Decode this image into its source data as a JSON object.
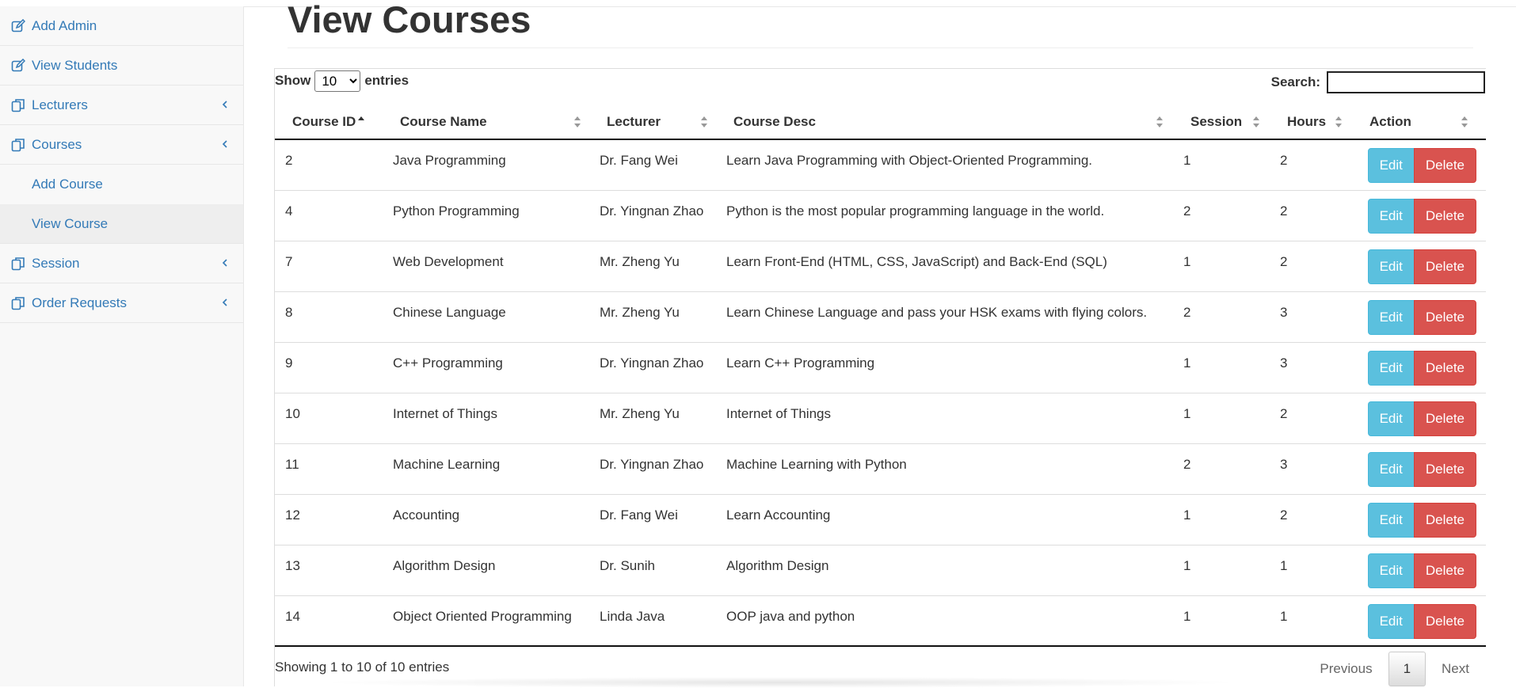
{
  "sidebar": {
    "items": [
      {
        "label": "Add Admin",
        "icon": "edit-icon"
      },
      {
        "label": "View Students",
        "icon": "edit-icon"
      },
      {
        "label": "Lecturers",
        "icon": "copy-icon"
      },
      {
        "label": "Courses",
        "icon": "copy-icon"
      },
      {
        "label": "Session",
        "icon": "copy-icon"
      },
      {
        "label": "Order Requests",
        "icon": "copy-icon"
      }
    ],
    "courses_sub": [
      {
        "label": "Add Course"
      },
      {
        "label": "View Course"
      }
    ],
    "active_sub": "View Course"
  },
  "page": {
    "title": "View Courses"
  },
  "datatable": {
    "show_label": "Show",
    "entries_label": "entries",
    "page_length": "10",
    "search_label": "Search:",
    "search_value": "",
    "columns": [
      "Course ID",
      "Course Name",
      "Lecturer",
      "Course Desc",
      "Session",
      "Hours",
      "Action"
    ],
    "rows": [
      {
        "id": "2",
        "name": "Java Programming",
        "lecturer": "Dr. Fang Wei",
        "desc": "Learn Java Programming with Object-Oriented Programming.",
        "session": "1",
        "hours": "2"
      },
      {
        "id": "4",
        "name": "Python Programming",
        "lecturer": "Dr. Yingnan Zhao",
        "desc": "Python is the most popular programming language in the world.",
        "session": "2",
        "hours": "2"
      },
      {
        "id": "7",
        "name": "Web Development",
        "lecturer": "Mr. Zheng Yu",
        "desc": "Learn Front-End (HTML, CSS, JavaScript) and Back-End (SQL)",
        "session": "1",
        "hours": "2"
      },
      {
        "id": "8",
        "name": "Chinese Language",
        "lecturer": "Mr. Zheng Yu",
        "desc": "Learn Chinese Language and pass your HSK exams with flying colors.",
        "session": "2",
        "hours": "3"
      },
      {
        "id": "9",
        "name": "C++ Programming",
        "lecturer": "Dr. Yingnan Zhao",
        "desc": "Learn C++ Programming",
        "session": "1",
        "hours": "3"
      },
      {
        "id": "10",
        "name": "Internet of Things",
        "lecturer": "Mr. Zheng Yu",
        "desc": "Internet of Things",
        "session": "1",
        "hours": "2"
      },
      {
        "id": "11",
        "name": "Machine Learning",
        "lecturer": "Dr. Yingnan Zhao",
        "desc": "Machine Learning with Python",
        "session": "2",
        "hours": "3"
      },
      {
        "id": "12",
        "name": "Accounting",
        "lecturer": "Dr. Fang Wei",
        "desc": "Learn Accounting",
        "session": "1",
        "hours": "2"
      },
      {
        "id": "13",
        "name": "Algorithm Design",
        "lecturer": "Dr. Sunih",
        "desc": "Algorithm Design",
        "session": "1",
        "hours": "1"
      },
      {
        "id": "14",
        "name": "Object Oriented Programming",
        "lecturer": "Linda Java",
        "desc": "OOP java and python",
        "session": "1",
        "hours": "1"
      }
    ],
    "edit_label": "Edit",
    "delete_label": "Delete",
    "info": "Showing 1 to 10 of 10 entries",
    "pagination": {
      "previous": "Previous",
      "current": "1",
      "next": "Next"
    }
  },
  "colors": {
    "link": "#337ab7",
    "edit_button": "#5bc0de",
    "delete_button": "#d9534f",
    "sidebar_bg": "#f8f8f8"
  }
}
